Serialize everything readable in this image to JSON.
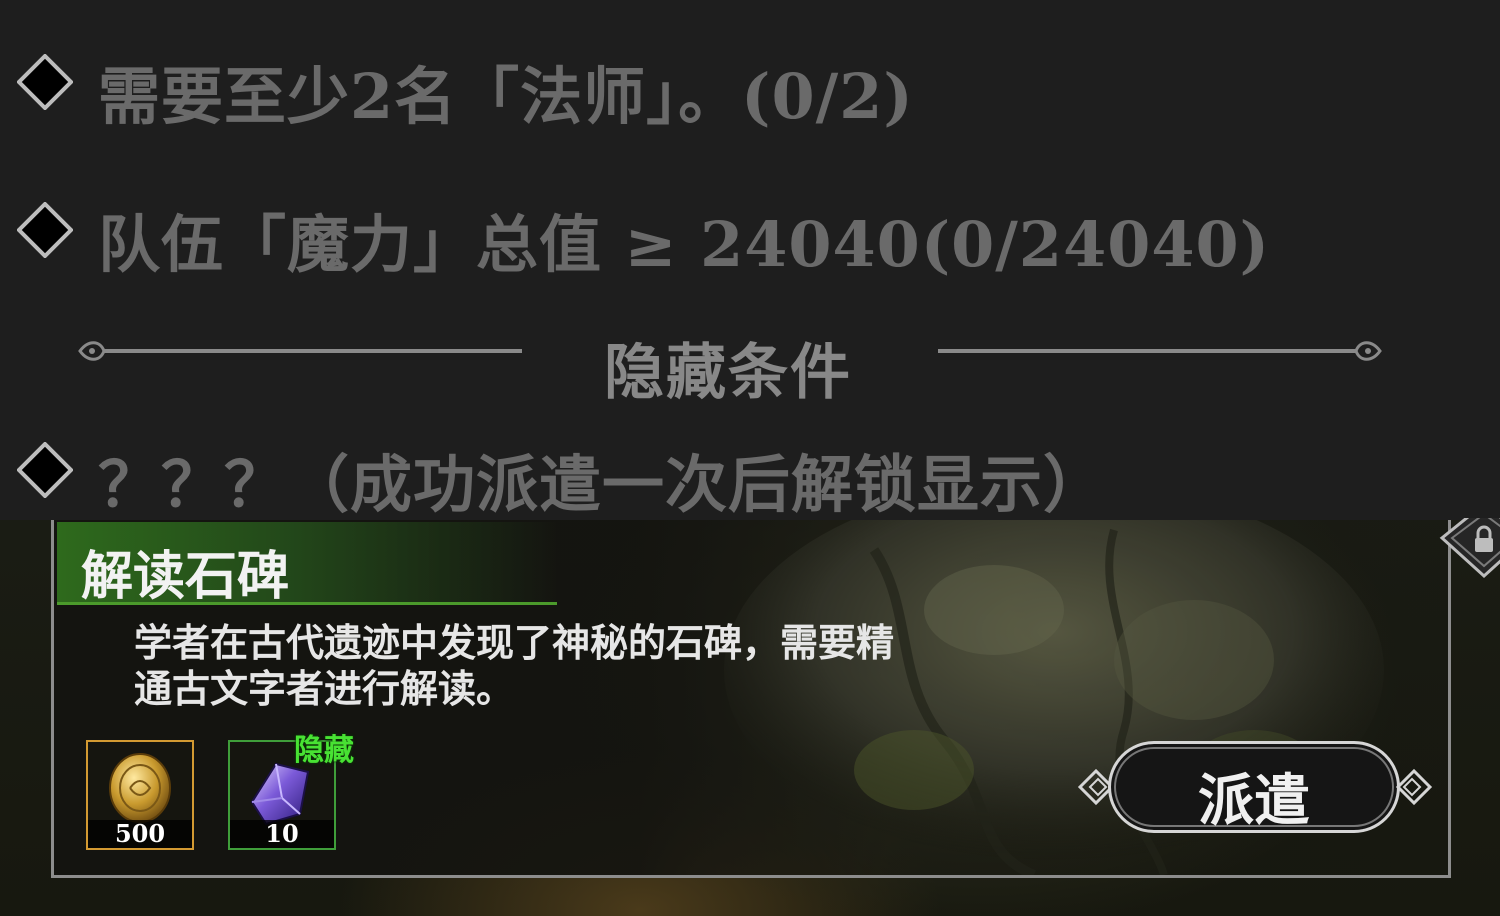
{
  "conditions": {
    "mage_requirement": "需要至少2名「法师」。(0/2)",
    "magic_total": "队伍「魔力」总值 ≥ 24040(0/24040)",
    "hidden_section_title": "隐藏条件",
    "hidden_condition": "？？？（成功派遣一次后解锁显示）"
  },
  "mission": {
    "title": "解读石碑",
    "description_line1": "学者在古代遗迹中发现了神秘的石碑，需要精",
    "description_line2": "通古文字者进行解读。",
    "rewards": [
      {
        "icon": "gold-coin-icon",
        "quantity": "500"
      },
      {
        "icon": "crystal-icon",
        "quantity": "10",
        "tag": "隐藏"
      }
    ],
    "dispatch_label": "派遣"
  },
  "colors": {
    "condition_text": "#6a6a6a",
    "title_green": "#2e6a1c",
    "hidden_tag_green": "#48e233",
    "coin_border": "#d39a32",
    "crystal_border": "#3f9e3a"
  }
}
